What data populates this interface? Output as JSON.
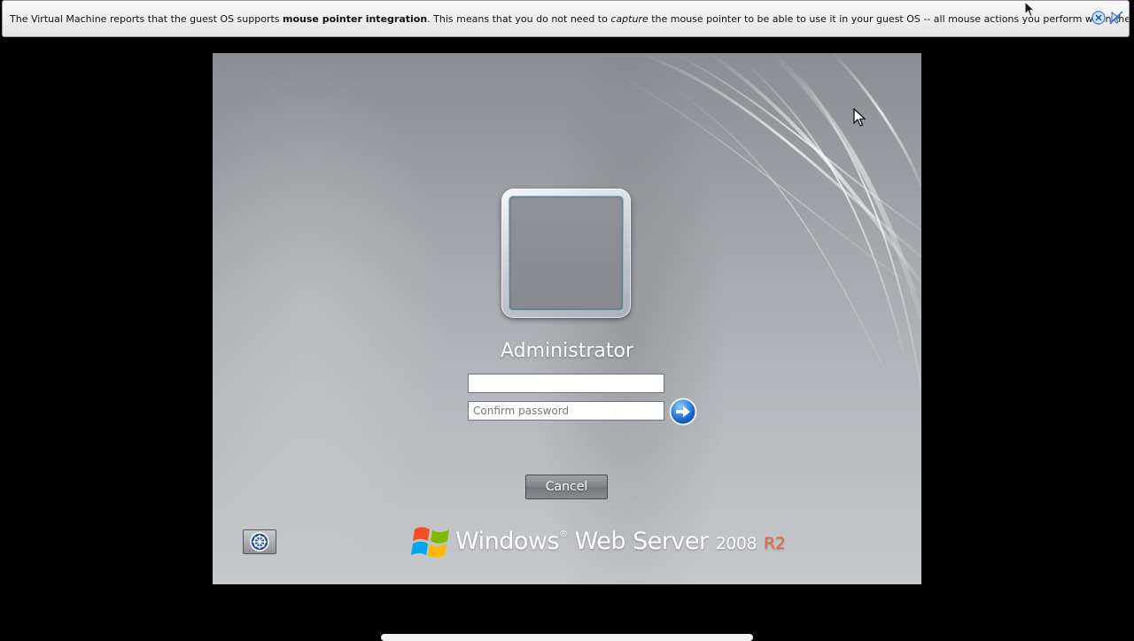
{
  "notification": {
    "text_1": "The Virtual Machine reports that the guest OS supports ",
    "text_bold": "mouse pointer integration",
    "text_2": ". This means that you do not need to ",
    "text_italic": "capture",
    "text_3": " the mouse pointer to be able to use it in your guest OS -- all mouse actions you perform when the mouse pointer is over",
    "close_icon": "close-icon",
    "disable_icon": "mouse-integration-off-icon"
  },
  "login": {
    "username": "Administrator",
    "password_value": "",
    "confirm_placeholder": "Confirm password",
    "submit_icon": "arrow-right-icon",
    "cancel_label": "Cancel"
  },
  "branding": {
    "windows": "Windows",
    "trademark": "®",
    "product": "Web Server",
    "year": "2008",
    "edition": "R2"
  },
  "colors": {
    "accent_blue": "#1f6fd6",
    "edition_orange": "#e5683a"
  }
}
